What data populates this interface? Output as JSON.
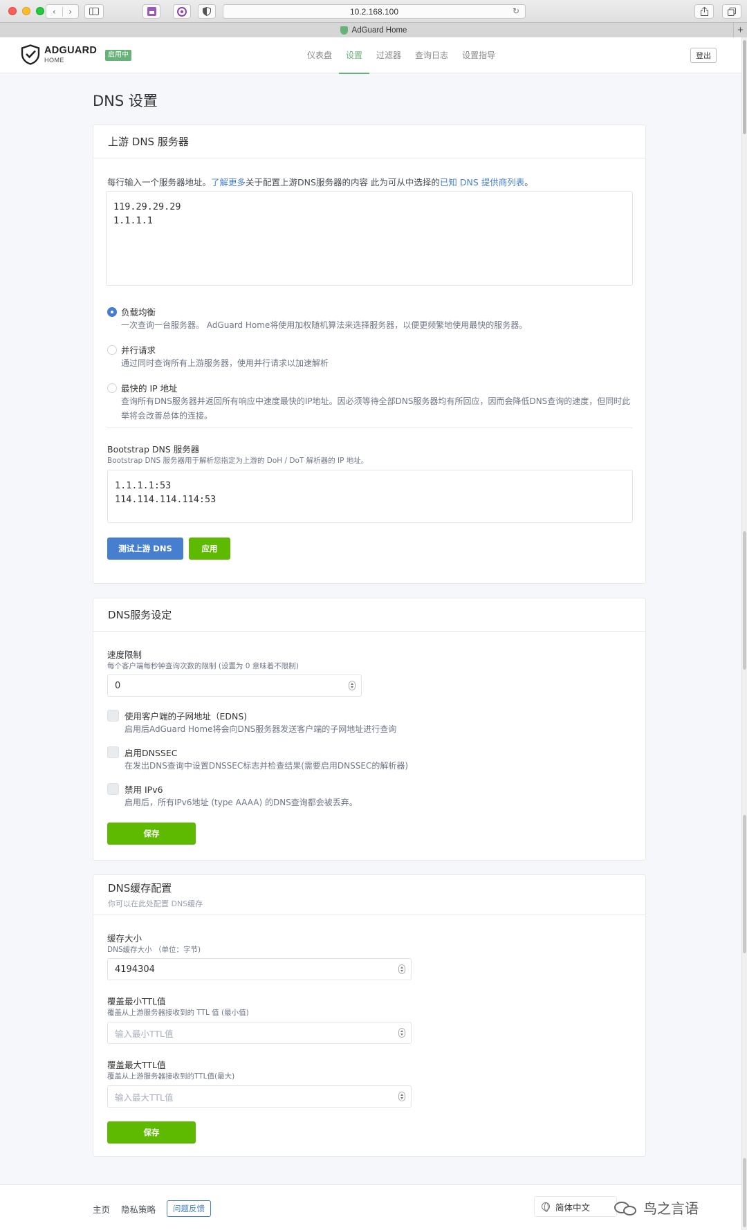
{
  "browser": {
    "url": "10.2.168.100",
    "tab_title": "AdGuard Home"
  },
  "header": {
    "logo_line1": "ADGUARD",
    "logo_line2": "HOME",
    "status_badge": "启用中",
    "nav": [
      "仪表盘",
      "设置",
      "过滤器",
      "查询日志",
      "设置指导"
    ],
    "active_nav": "设置",
    "logout": "登出"
  },
  "page": {
    "title": "DNS 设置"
  },
  "upstream": {
    "title": "上游 DNS 服务器",
    "hint_before": "每行输入一个服务器地址。",
    "hint_link1": "了解更多",
    "hint_middle": "关于配置上游DNS服务器的内容 此为可从中选择的",
    "hint_link2": "已知 DNS 提供商列表",
    "hint_end": "。",
    "servers": "119.29.29.29\n1.1.1.1",
    "options": [
      {
        "title": "负载均衡",
        "desc": "一次查询一台服务器。 AdGuard Home将使用加权随机算法来选择服务器，以便更频繁地使用最快的服务器。",
        "selected": true
      },
      {
        "title": "并行请求",
        "desc": "通过同时查询所有上游服务器，使用并行请求以加速解析",
        "selected": false
      },
      {
        "title": "最快的 IP 地址",
        "desc": "查询所有DNS服务器并返回所有响应中速度最快的IP地址。因必须等待全部DNS服务器均有所回应，因而会降低DNS查询的速度，但同时此举将会改善总体的连接。",
        "selected": false
      }
    ],
    "bootstrap_label": "Bootstrap DNS 服务器",
    "bootstrap_desc": "Bootstrap DNS 服务器用于解析您指定为上游的 DoH / DoT 解析器的 IP 地址。",
    "bootstrap_servers": "1.1.1.1:53\n114.114.114.114:53",
    "test_button": "测试上游 DNS",
    "apply_button": "应用"
  },
  "dns_service": {
    "title": "DNS服务设定",
    "rate_label": "速度限制",
    "rate_desc": "每个客户端每秒钟查询次数的限制 (设置为 0 意味着不限制)",
    "rate_value": "0",
    "checks": [
      {
        "title": "使用客户端的子网地址（EDNS)",
        "desc": "启用后AdGuard Home将会向DNS服务器发送客户端的子网地址进行查询"
      },
      {
        "title": "启用DNSSEC",
        "desc": "在发出DNS查询中设置DNSSEC标志并检查结果(需要启用DNSSEC的解析器)"
      },
      {
        "title": "禁用 IPv6",
        "desc": "启用后，所有IPv6地址 (type AAAA) 的DNS查询都会被丢弃。"
      }
    ],
    "save_button": "保存"
  },
  "cache": {
    "title": "DNS缓存配置",
    "subtitle": "你可以在此处配置 DNS缓存",
    "size_label": "缓存大小",
    "size_desc": "DNS缓存大小 （单位：字节)",
    "size_value": "4194304",
    "min_label": "覆盖最小TTL值",
    "min_desc": "覆盖从上游服务器接收到的 TTL 值 (最小值)",
    "min_placeholder": "输入最小TTL值",
    "max_label": "覆盖最大TTL值",
    "max_desc": "覆盖从上游服务器接收到的TTL值(最大)",
    "max_placeholder": "输入最大TTL值",
    "save_button": "保存"
  },
  "footer": {
    "home": "主页",
    "privacy": "隐私策略",
    "feedback": "问题反馈",
    "language": "简体中文",
    "watermark": "鸟之言语"
  },
  "colors": {
    "accent_green": "#67b279",
    "primary_blue": "#467fcf",
    "button_green": "#5eba00"
  }
}
